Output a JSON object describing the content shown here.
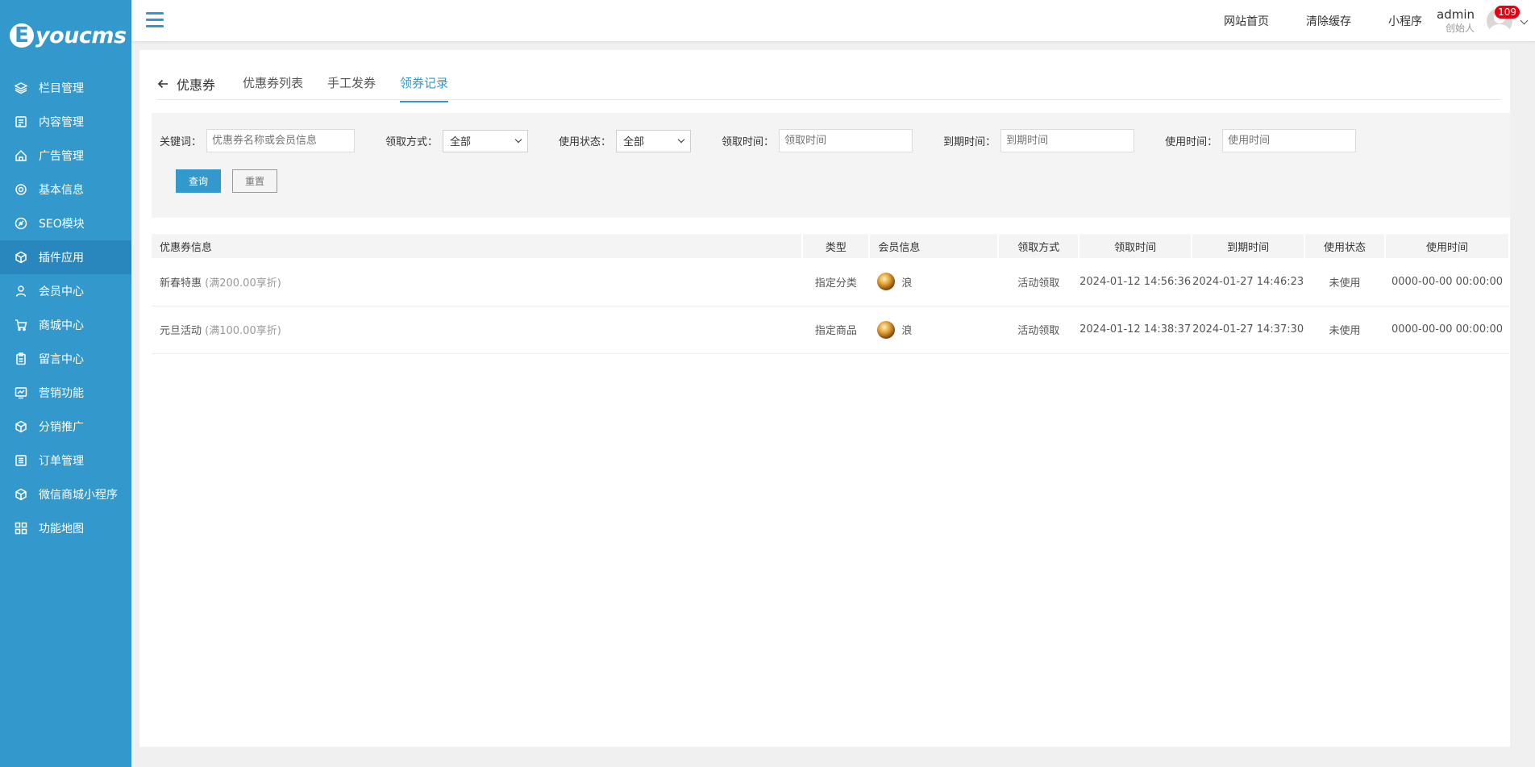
{
  "brand": {
    "mark": "E",
    "text": "youcms"
  },
  "sidebar": {
    "items": [
      {
        "label": "栏目管理",
        "icon": "layers-icon"
      },
      {
        "label": "内容管理",
        "icon": "document-icon"
      },
      {
        "label": "广告管理",
        "icon": "home-icon"
      },
      {
        "label": "基本信息",
        "icon": "gear-icon"
      },
      {
        "label": "SEO模块",
        "icon": "link-icon"
      },
      {
        "label": "插件应用",
        "icon": "cube-icon"
      },
      {
        "label": "会员中心",
        "icon": "user-icon"
      },
      {
        "label": "商城中心",
        "icon": "cart-icon"
      },
      {
        "label": "留言中心",
        "icon": "clipboard-icon"
      },
      {
        "label": "营销功能",
        "icon": "chart-icon"
      },
      {
        "label": "分销推广",
        "icon": "cube-icon"
      },
      {
        "label": "订单管理",
        "icon": "list-icon"
      },
      {
        "label": "微信商城小程序",
        "icon": "cube-icon"
      },
      {
        "label": "功能地图",
        "icon": "grid-icon"
      }
    ],
    "active_index": 5
  },
  "topbar": {
    "links": [
      "网站首页",
      "清除缓存",
      "小程序"
    ],
    "user_name": "admin",
    "user_role": "创始人",
    "badge": "109"
  },
  "tabs": {
    "back_label": "优惠券",
    "items": [
      "优惠券列表",
      "手工发券",
      "领券记录"
    ],
    "active_index": 2
  },
  "filter": {
    "keyword_label": "关键词：",
    "keyword_placeholder": "优惠券名称或会员信息",
    "method_label": "领取方式：",
    "method_value": "全部",
    "status_label": "使用状态：",
    "status_value": "全部",
    "get_time_label": "领取时间：",
    "get_time_placeholder": "领取时间",
    "expire_time_label": "到期时间：",
    "expire_time_placeholder": "到期时间",
    "use_time_label": "使用时间：",
    "use_time_placeholder": "使用时间",
    "search_button": "查询",
    "reset_button": "重置"
  },
  "table": {
    "columns": [
      "优惠券信息",
      "类型",
      "会员信息",
      "领取方式",
      "领取时间",
      "到期时间",
      "使用状态",
      "使用时间"
    ],
    "rows": [
      {
        "name": "新春特惠",
        "detail": "(满200.00享折)",
        "type": "指定分类",
        "member": "浪",
        "method": "活动领取",
        "get_time": "2024-01-12 14:56:36",
        "expire_time": "2024-01-27 14:46:23",
        "status": "未使用",
        "use_time": "0000-00-00 00:00:00"
      },
      {
        "name": "元旦活动",
        "detail": "(满100.00享折)",
        "type": "指定商品",
        "member": "浪",
        "method": "活动领取",
        "get_time": "2024-01-12 14:38:37",
        "expire_time": "2024-01-27 14:37:30",
        "status": "未使用",
        "use_time": "0000-00-00 00:00:00"
      }
    ]
  },
  "colors": {
    "primary": "#3398cc",
    "danger": "#e60012"
  }
}
